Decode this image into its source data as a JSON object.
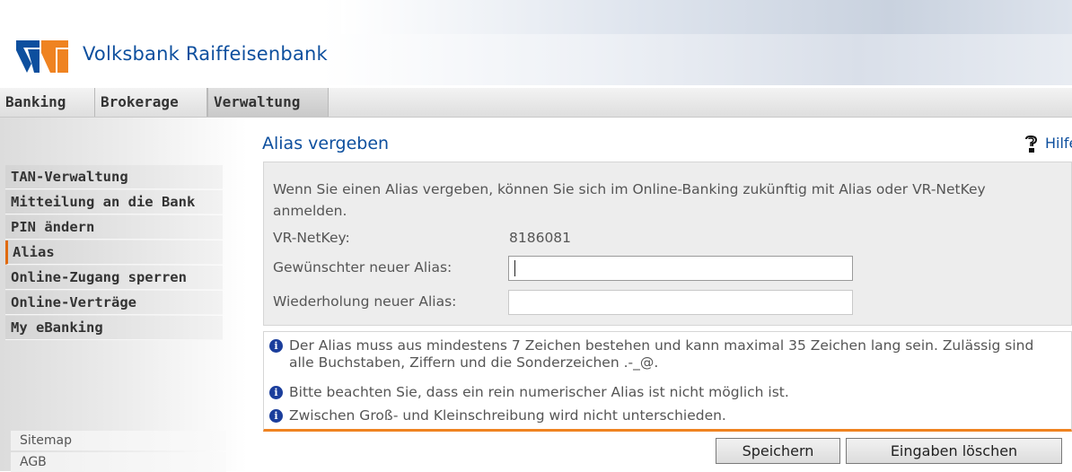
{
  "brand": {
    "name": "Volksbank Raiffeisenbank"
  },
  "tabs": [
    {
      "label": "Banking",
      "active": false
    },
    {
      "label": "Brokerage",
      "active": false
    },
    {
      "label": "Verwaltung",
      "active": true
    }
  ],
  "sidebar": {
    "items": [
      {
        "label": "TAN-Verwaltung",
        "active": false
      },
      {
        "label": "Mitteilung an die Bank",
        "active": false
      },
      {
        "label": "PIN ändern",
        "active": false
      },
      {
        "label": "Alias",
        "active": true
      },
      {
        "label": "Online-Zugang sperren",
        "active": false
      },
      {
        "label": "Online-Verträge",
        "active": false
      },
      {
        "label": "My eBanking",
        "active": false
      }
    ],
    "links": [
      {
        "label": "Sitemap"
      },
      {
        "label": "AGB"
      }
    ]
  },
  "page": {
    "title": "Alias vergeben",
    "help_label": "Hilfe",
    "intro": "Wenn Sie einen Alias vergeben, können Sie sich im Online-Banking zukünftig mit Alias oder VR-NetKey anmelden.",
    "netkey_label": "VR-NetKey:",
    "netkey_value": "8186081",
    "new_alias_label": "Gewünschter neuer Alias:",
    "new_alias_value": "",
    "repeat_alias_label": "Wiederholung neuer Alias:",
    "repeat_alias_value": ""
  },
  "info": [
    "Der Alias muss aus mindestens 7 Zeichen bestehen und kann maximal 35 Zeichen lang sein. Zulässig sind alle Buchstaben, Ziffern und die Sonderzeichen .-_@.",
    "Bitte beachten Sie, dass ein rein numerischer Alias ist nicht möglich ist.",
    "Zwischen Groß- und Kleinschreibung wird nicht unterschieden."
  ],
  "buttons": {
    "save": "Speichern",
    "clear": "Eingaben löschen"
  },
  "colors": {
    "brand_blue": "#0d4f9e",
    "accent_orange": "#ef8321",
    "info_blue": "#1b3e9c"
  },
  "icons": {
    "logo": "volksbank-logo",
    "help": "help-icon",
    "info": "info-icon"
  }
}
